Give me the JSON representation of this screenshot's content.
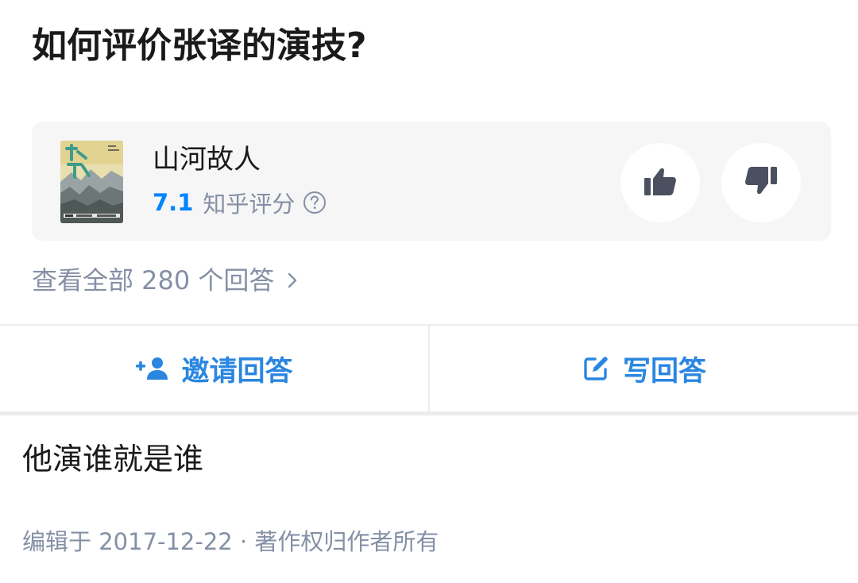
{
  "question": {
    "title": "如何评价张译的演技?"
  },
  "movie_card": {
    "name": "山河故人",
    "score": "7.1",
    "score_label": "知乎评分",
    "help_icon": "question-circle-icon",
    "vote_up_icon": "thumbs-up-icon",
    "vote_down_icon": "thumbs-down-icon"
  },
  "answers_link": {
    "label": "查看全部 280 个回答"
  },
  "actions": {
    "invite_label": "邀请回答",
    "invite_icon": "add-user-icon",
    "write_label": "写回答",
    "write_icon": "edit-icon"
  },
  "answer": {
    "text": "他演谁就是谁",
    "meta": "编辑于 2017-12-22 · 著作权归作者所有"
  },
  "colors": {
    "accent": "#0084ff",
    "action_blue": "#2a86e0",
    "muted": "#8590a6",
    "card_bg": "#f6f6f6",
    "icon_dark": "#4a5060"
  }
}
